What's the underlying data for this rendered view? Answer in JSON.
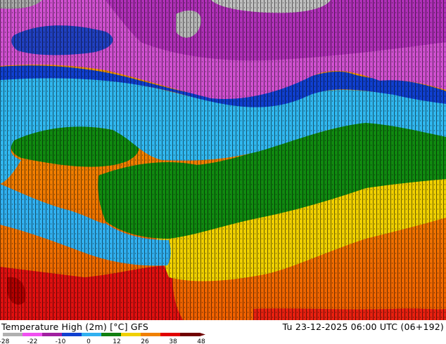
{
  "header": {
    "title": "Temperature High (2m) [°C] GFS",
    "valid_time": "Tu 23-12-2025 06:00 UTC (06+192)"
  },
  "legend": {
    "ticks": [
      "-28",
      "-22",
      "-10",
      "0",
      "12",
      "26",
      "38",
      "48"
    ],
    "colors": [
      "#b0b0b0",
      "#f050f0",
      "#a020a0",
      "#1040d0",
      "#30b0f0",
      "#108010",
      "#f0d000",
      "#f08000",
      "#e00000",
      "#700000"
    ]
  },
  "map": {
    "zones": [
      "below -10",
      "-10 to 0",
      "0 to 12",
      "12 to 26",
      "26 to 38"
    ]
  }
}
